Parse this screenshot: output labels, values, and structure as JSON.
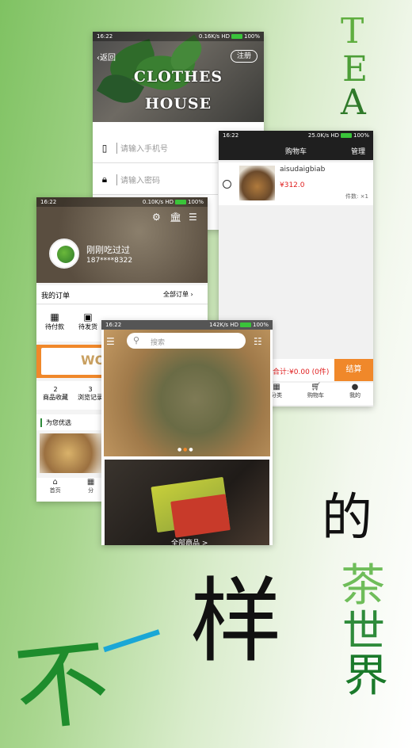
{
  "login": {
    "status": {
      "time": "16:22",
      "speed": "0.16K/s",
      "net": "HD",
      "battery": "100%"
    },
    "back_label": "返回",
    "register_label": "注册",
    "hero_line1": "CLOTHES",
    "hero_line2": "HOUSE",
    "phone_placeholder": "请输入手机号",
    "password_placeholder": "请输入密码"
  },
  "cart": {
    "status": {
      "time": "16:22",
      "speed": "25.0K/s",
      "net": "HD",
      "battery": "100%"
    },
    "title": "购物车",
    "manage_label": "管理",
    "item": {
      "name": "aisudaigbiab",
      "price": "¥312.0",
      "qty": "件数: ×1"
    },
    "total_label": "合计:",
    "total_value": "¥0.00 (0件)",
    "checkout_label": "结算",
    "tabs": [
      {
        "label": "分类"
      },
      {
        "label": "购物车"
      },
      {
        "label": "我的"
      }
    ]
  },
  "profile": {
    "status": {
      "time": "16:22",
      "speed": "0.10K/s",
      "net": "HD",
      "battery": "100%"
    },
    "username": "刚刚吃过过",
    "phone": "187****8322",
    "orders_label": "我的订单",
    "all_orders_label": "全部订单",
    "order_items": [
      {
        "label": "待付款"
      },
      {
        "label": "待发货"
      }
    ],
    "banner_text": "WO",
    "stats": [
      {
        "value": "2",
        "label": "商品收藏"
      },
      {
        "value": "3",
        "label": "浏览记录"
      }
    ],
    "recommend_label": "为您优选",
    "tabs": [
      {
        "label": "首页"
      },
      {
        "label": "分"
      }
    ]
  },
  "home": {
    "status": {
      "time": "16:22",
      "speed": "142K/s",
      "net": "HD",
      "battery": "100%"
    },
    "search_placeholder": "搜索",
    "all_goods_label": "全部商品 >"
  },
  "slogan": {
    "tea_letters": [
      "T",
      "E",
      "A"
    ],
    "char_bu": "不",
    "char_yi": "一",
    "char_yang": "样",
    "char_de": "的",
    "char_cha": "茶",
    "char_shi": "世",
    "char_jie": "界"
  },
  "colors": {
    "accent_orange": "#f0882a",
    "price_red": "#e02020",
    "status_green": "#3ac43a",
    "leaf_green": "#2e8b3a"
  }
}
